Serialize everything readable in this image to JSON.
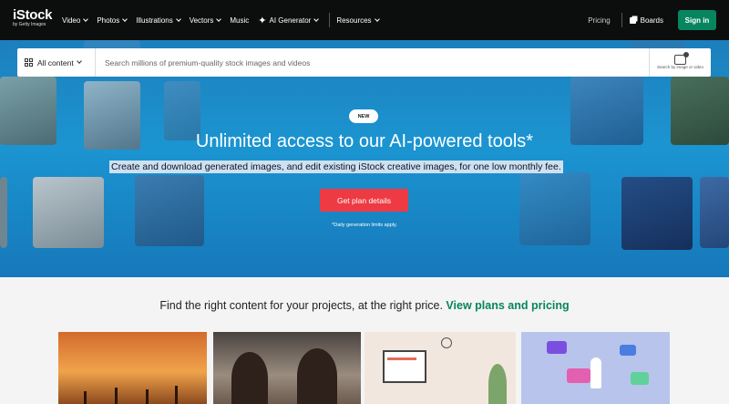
{
  "nav": {
    "logo": "iStock",
    "logo_sub": "by Getty Images",
    "menu": [
      {
        "label": "Video",
        "dropdown": true
      },
      {
        "label": "Photos",
        "dropdown": true
      },
      {
        "label": "Illustrations",
        "dropdown": true
      },
      {
        "label": "Vectors",
        "dropdown": true
      },
      {
        "label": "Music",
        "dropdown": false
      },
      {
        "label": "AI Generator",
        "dropdown": true,
        "icon": "sparkle-icon"
      }
    ],
    "resources": "Resources",
    "pricing": "Pricing",
    "boards": "Boards",
    "signin": "Sign in"
  },
  "search": {
    "filter_label": "All content",
    "placeholder": "Search millions of premium-quality stock images and videos",
    "image_search_label": "Search by image or video"
  },
  "hero": {
    "badge": "NEW",
    "headline": "Unlimited access to our AI-powered tools*",
    "subline": "Create and download generated images, and edit existing iStock creative images, for one low monthly fee.",
    "cta": "Get plan details",
    "disclaimer": "*Daily generation limits apply."
  },
  "lower": {
    "find_text": "Find the right content for your projects, at the right price.",
    "find_link": "View plans and pricing"
  },
  "colors": {
    "nav_bg": "#0c0d0d",
    "brand_green": "#07855f",
    "cta_red": "#ee3a43",
    "hero_blue": "#1b95d1"
  }
}
